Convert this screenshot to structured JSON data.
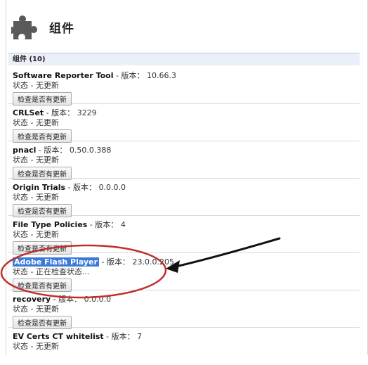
{
  "page": {
    "title": "组件"
  },
  "section": {
    "title": "组件 (10)"
  },
  "components": [
    {
      "name": "Software Reporter Tool",
      "version_label": " - 版本： ",
      "version": "10.66.3",
      "status": "状态 - 无更新",
      "button": "检查是否有更新"
    },
    {
      "name": "CRLSet",
      "version_label": " - 版本： ",
      "version": "3229",
      "status": "状态 - 无更新",
      "button": "检查是否有更新"
    },
    {
      "name": "pnacl",
      "version_label": " - 版本： ",
      "version": "0.50.0.388",
      "status": "状态 - 无更新",
      "button": "检查是否有更新"
    },
    {
      "name": "Origin Trials",
      "version_label": " - 版本： ",
      "version": "0.0.0.0",
      "status": "状态 - 无更新",
      "button": "检查是否有更新"
    },
    {
      "name": "File Type Policies",
      "version_label": " - 版本： ",
      "version": "4",
      "status": "状态 - 无更新",
      "button": "检查是否有更新"
    },
    {
      "name": "Adobe Flash Player",
      "version_label": " - 版本： ",
      "version": "23.0.0.205",
      "status": "状态 - 正在检查状态...",
      "button": "检查是否有更新",
      "selected": true
    },
    {
      "name": "recovery",
      "version_label": " - 版本： ",
      "version": "0.0.0.0",
      "status": "状态 - 无更新",
      "button": "检查是否有更新"
    },
    {
      "name": "EV Certs CT whitelist",
      "version_label": " - 版本： ",
      "version": "7",
      "status": "状态 - 无更新",
      "button": ""
    }
  ],
  "colors": {
    "selection": "#3b7ad9",
    "annotation_circle": "#c0302a",
    "annotation_arrow": "#111111",
    "section_bar": "#ebeff9"
  },
  "icons": {
    "header": "puzzle-piece-icon"
  }
}
